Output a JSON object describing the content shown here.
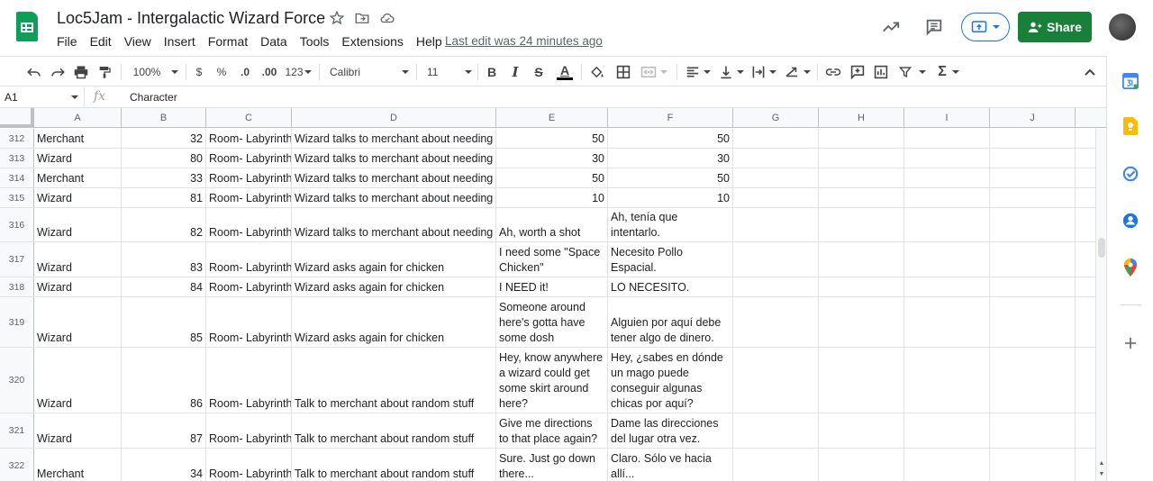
{
  "doc": {
    "title": "Loc5Jam - Intergalactic Wizard Force",
    "last_edit": "Last edit was 24 minutes ago",
    "share_label": "Share"
  },
  "menu": [
    "File",
    "Edit",
    "View",
    "Insert",
    "Format",
    "Data",
    "Tools",
    "Extensions",
    "Help"
  ],
  "toolbar": {
    "zoom": "100%",
    "currency": "$",
    "percent": "%",
    "dec_decrease": ".0",
    "dec_increase": ".00",
    "number_format": "123",
    "font": "Calibri",
    "font_size": "11",
    "bold": "B",
    "italic": "I",
    "strike": "S",
    "text_color": "A"
  },
  "formula_bar": {
    "cell_ref": "A1",
    "fx": "fx",
    "value": "Character"
  },
  "columns": [
    "A",
    "B",
    "C",
    "D",
    "E",
    "F",
    "G",
    "H",
    "I",
    "J"
  ],
  "rows": [
    {
      "num": "312",
      "a": "Merchant",
      "b": "32",
      "c": "Room- Labyrinth",
      "d": "Wizard talks to merchant about needing",
      "e": [
        "50"
      ],
      "f": [
        "50"
      ]
    },
    {
      "num": "313",
      "a": "Wizard",
      "b": "80",
      "c": "Room- Labyrinth",
      "d": "Wizard talks to merchant about needing",
      "e": [
        "30"
      ],
      "f": [
        "30"
      ]
    },
    {
      "num": "314",
      "a": "Merchant",
      "b": "33",
      "c": "Room- Labyrinth",
      "d": "Wizard talks to merchant about needing",
      "e": [
        "50"
      ],
      "f": [
        "50"
      ]
    },
    {
      "num": "315",
      "a": "Wizard",
      "b": "81",
      "c": "Room- Labyrinth",
      "d": "Wizard talks to merchant about needing",
      "e": [
        "10"
      ],
      "f": [
        "10"
      ]
    },
    {
      "num": "316",
      "a": "Wizard",
      "b": "82",
      "c": "Room- Labyrinth",
      "d": "Wizard talks to merchant about needing",
      "e": [
        "Ah, worth a shot"
      ],
      "f": [
        "Ah, tenía que",
        "intentarlo."
      ]
    },
    {
      "num": "317",
      "a": "Wizard",
      "b": "83",
      "c": "Room- Labyrinth",
      "d": "Wizard asks again for chicken",
      "e": [
        "I need some \"Space",
        "Chicken\""
      ],
      "f": [
        "Necesito Pollo Espacial."
      ]
    },
    {
      "num": "318",
      "a": "Wizard",
      "b": "84",
      "c": "Room- Labyrinth",
      "d": "Wizard asks again for chicken",
      "e": [
        "I NEED it!"
      ],
      "f": [
        "LO NECESITO."
      ]
    },
    {
      "num": "319",
      "a": "Wizard",
      "b": "85",
      "c": "Room- Labyrinth",
      "d": "Wizard asks again for chicken",
      "e": [
        "Someone around",
        "here's gotta have",
        "some dosh"
      ],
      "f": [
        "Alguien por aquí debe",
        "tener algo de dinero."
      ]
    },
    {
      "num": "320",
      "a": "Wizard",
      "b": "86",
      "c": "Room- Labyrinth",
      "d": "Talk to merchant about random stuff",
      "e": [
        "Hey, know anywhere",
        "a wizard could get",
        "some skirt around",
        "here?"
      ],
      "f": [
        "Hey, ¿sabes en dónde",
        "un mago puede",
        "conseguir algunas",
        "chicas por aquí?"
      ]
    },
    {
      "num": "321",
      "a": "Wizard",
      "b": "87",
      "c": "Room- Labyrinth",
      "d": "Talk to merchant about random stuff",
      "e": [
        "Give me directions",
        "to that place again?"
      ],
      "f": [
        "Dame las direcciones",
        "del lugar otra vez."
      ]
    },
    {
      "num": "322",
      "a": "Merchant",
      "b": "34",
      "c": "Room- Labyrinth",
      "d": "Talk to merchant about random stuff",
      "e": [
        "Sure. Just go down",
        "there..."
      ],
      "f": [
        "Claro. Sólo ve hacia",
        "allí..."
      ]
    }
  ],
  "colors": {
    "brand_green": "#0f9d58",
    "share_green": "#188038",
    "accent_blue": "#1a73e8"
  }
}
